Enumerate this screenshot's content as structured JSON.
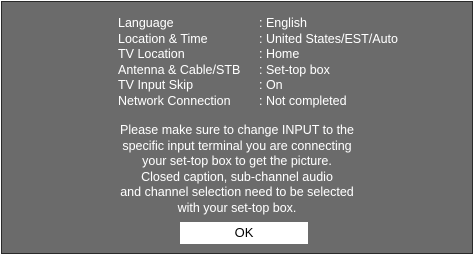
{
  "settings": [
    {
      "label": "Language",
      "value": ": English"
    },
    {
      "label": "Location & Time",
      "value": ": United States/EST/Auto"
    },
    {
      "label": "TV Location",
      "value": ": Home"
    },
    {
      "label": "Antenna & Cable/STB",
      "value": ": Set-top box"
    },
    {
      "label": "TV Input Skip",
      "value": ": On"
    },
    {
      "label": "Network Connection",
      "value": ": Not completed"
    }
  ],
  "message": {
    "lines": [
      "Please make sure to change INPUT to the",
      "specific input terminal you are connecting",
      "your set-top box to get the picture.",
      "Closed caption, sub-channel audio",
      "and channel selection need to be selected",
      "with your set-top box."
    ]
  },
  "ok_button": {
    "label": "OK"
  },
  "colors": {
    "background": "#6b6b6b",
    "text": "#ffffff",
    "button_bg": "#ffffff",
    "button_text": "#000000"
  }
}
